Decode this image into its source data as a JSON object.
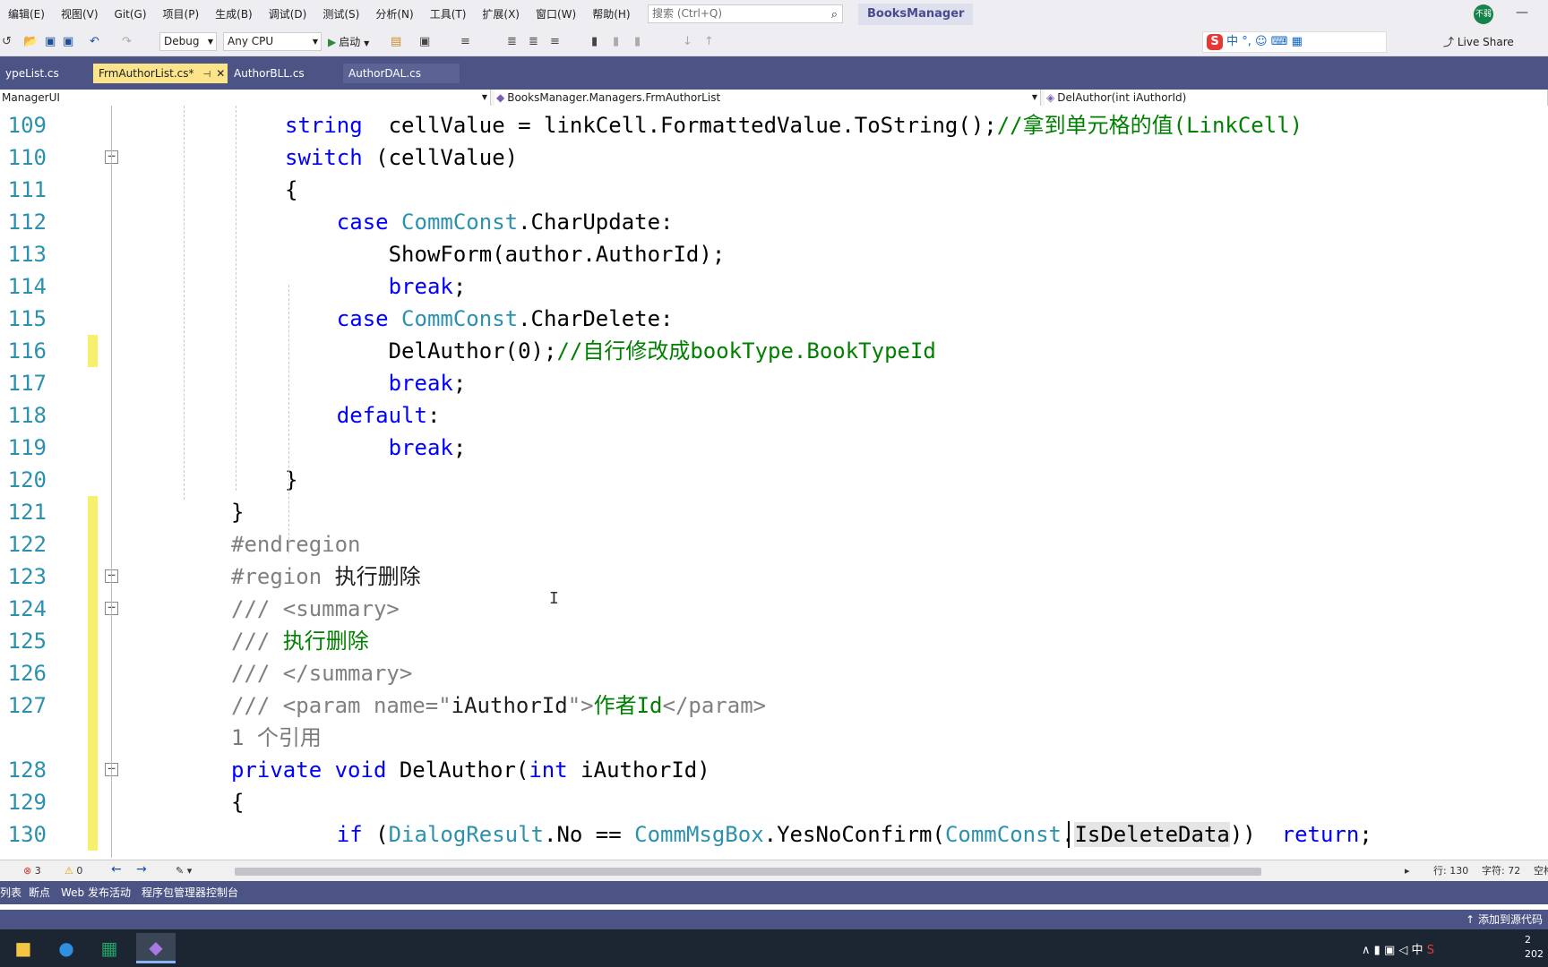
{
  "menu": [
    "编辑(E)",
    "视图(V)",
    "Git(G)",
    "项目(P)",
    "生成(B)",
    "调试(D)",
    "测试(S)",
    "分析(N)",
    "工具(T)",
    "扩展(X)",
    "窗口(W)",
    "帮助(H)"
  ],
  "search": {
    "placeholder": "搜索 (Ctrl+Q)"
  },
  "solution_name": "BooksManager",
  "avatar_text": "不弱",
  "toolbar": {
    "config": "Debug",
    "platform": "Any CPU",
    "start_label": "启动",
    "live_share": "Live Share",
    "ime_text": "中 °,"
  },
  "tabs": [
    {
      "label": "ypeList.cs",
      "active": false
    },
    {
      "label": "FrmAuthorList.cs*",
      "active": true
    },
    {
      "label": "AuthorBLL.cs",
      "active": false
    },
    {
      "label": "AuthorDAL.cs",
      "active": false
    }
  ],
  "nav": {
    "project": "ManagerUI",
    "class": "BooksManager.Managers.FrmAuthorList",
    "member": "DelAuthor(int iAuthorId)"
  },
  "code_lines": [
    {
      "n": "109",
      "tokens": [
        [
          "t-kw",
          "string"
        ],
        [
          "",
          "  cellValue = linkCell.FormattedValue.ToString();"
        ],
        [
          "t-cm",
          "//拿到单元格的值(LinkCell)"
        ]
      ]
    },
    {
      "n": "110",
      "tokens": [
        [
          "t-kw",
          "switch"
        ],
        [
          "",
          " (cellValue)"
        ]
      ]
    },
    {
      "n": "111",
      "tokens": [
        [
          "",
          "{"
        ]
      ]
    },
    {
      "n": "112",
      "tokens": [
        [
          "",
          "    "
        ],
        [
          "t-kw",
          "case"
        ],
        [
          "",
          " "
        ],
        [
          "t-ty",
          "CommConst"
        ],
        [
          "",
          ".CharUpdate:"
        ]
      ]
    },
    {
      "n": "113",
      "tokens": [
        [
          "",
          "        ShowForm(author.AuthorId);"
        ]
      ]
    },
    {
      "n": "114",
      "tokens": [
        [
          "",
          "        "
        ],
        [
          "t-kw",
          "break"
        ],
        [
          "",
          ";"
        ]
      ]
    },
    {
      "n": "115",
      "tokens": [
        [
          "",
          "    "
        ],
        [
          "t-kw",
          "case"
        ],
        [
          "",
          " "
        ],
        [
          "t-ty",
          "CommConst"
        ],
        [
          "",
          ".CharDelete:"
        ]
      ]
    },
    {
      "n": "116",
      "tokens": [
        [
          "",
          "        DelAuthor(0);"
        ],
        [
          "t-cm",
          "//自行修改成bookType.BookTypeId"
        ]
      ]
    },
    {
      "n": "117",
      "tokens": [
        [
          "",
          "        "
        ],
        [
          "t-kw",
          "break"
        ],
        [
          "",
          ";"
        ]
      ]
    },
    {
      "n": "118",
      "tokens": [
        [
          "",
          "    "
        ],
        [
          "t-kw",
          "default"
        ],
        [
          "",
          ":"
        ]
      ]
    },
    {
      "n": "119",
      "tokens": [
        [
          "",
          "        "
        ],
        [
          "t-kw",
          "break"
        ],
        [
          "",
          ";"
        ]
      ]
    },
    {
      "n": "120",
      "tokens": [
        [
          "",
          "}"
        ]
      ]
    },
    {
      "n": "121",
      "tokens": [
        [
          "",
          "}"
        ]
      ]
    },
    {
      "n": "122",
      "tokens": [
        [
          "t-pre",
          "#endregion"
        ]
      ]
    },
    {
      "n": "123",
      "tokens": [
        [
          "t-pre",
          "#region"
        ],
        [
          "t-rx",
          " 执行删除"
        ]
      ]
    },
    {
      "n": "124",
      "tokens": [
        [
          "t-pre",
          "/// <summary>"
        ]
      ]
    },
    {
      "n": "125",
      "tokens": [
        [
          "t-pre",
          "/// "
        ],
        [
          "t-cm",
          "执行删除"
        ]
      ]
    },
    {
      "n": "126",
      "tokens": [
        [
          "t-pre",
          "/// </summary>"
        ]
      ]
    },
    {
      "n": "127",
      "tokens": [
        [
          "t-pre",
          "/// <param name=\""
        ],
        [
          "t-rx",
          "iAuthorId"
        ],
        [
          "t-pre",
          "\">"
        ],
        [
          "t-cm",
          "作者Id"
        ],
        [
          "t-pre",
          "</param>"
        ]
      ]
    },
    {
      "n": "",
      "tokens": [
        [
          "t-ref",
          "1 个引用"
        ]
      ]
    },
    {
      "n": "128",
      "tokens": [
        [
          "t-kw",
          "private"
        ],
        [
          "",
          " "
        ],
        [
          "t-kw",
          "void"
        ],
        [
          "",
          " DelAuthor("
        ],
        [
          "t-kw",
          "int"
        ],
        [
          "",
          " iAuthorId)"
        ]
      ]
    },
    {
      "n": "129",
      "tokens": [
        [
          "",
          "{"
        ]
      ]
    },
    {
      "n": "130",
      "tokens": [
        [
          "",
          "    "
        ],
        [
          "t-kw",
          "if"
        ],
        [
          "",
          " ("
        ],
        [
          "t-ty",
          "DialogResult"
        ],
        [
          "",
          ".No == "
        ],
        [
          "t-ty",
          "CommMsgBox"
        ],
        [
          "",
          ".YesNoConfirm("
        ],
        [
          "t-ty",
          "CommConst"
        ],
        [
          "",
          "."
        ],
        [
          "hl",
          "IsDeleteData"
        ],
        [
          "",
          "))  "
        ],
        [
          "t-kw",
          "return"
        ],
        [
          "",
          ";"
        ]
      ]
    }
  ],
  "editor_status": {
    "errors": "3",
    "warnings": "0",
    "line": "行: 130",
    "col": "字符: 72",
    "mode": "空格"
  },
  "tool_windows": [
    "列表",
    "断点",
    "Web 发布活动",
    "程序包管理器控制台"
  ],
  "statusbar": {
    "source_control": "添加到源代码"
  },
  "taskbar": {
    "apps": [
      "file-explorer-icon",
      "sogou-browser-icon",
      "excel-icon",
      "visual-studio-icon"
    ],
    "tray_ime": "中",
    "clock_time": "2",
    "clock_date": "202"
  },
  "colors": {
    "tab_active": "#fce48a",
    "tabstrip": "#4b5484",
    "change_marker": "#f6f06a",
    "keyword": "#0000ff",
    "type": "#2b91af",
    "comment": "#008000"
  }
}
